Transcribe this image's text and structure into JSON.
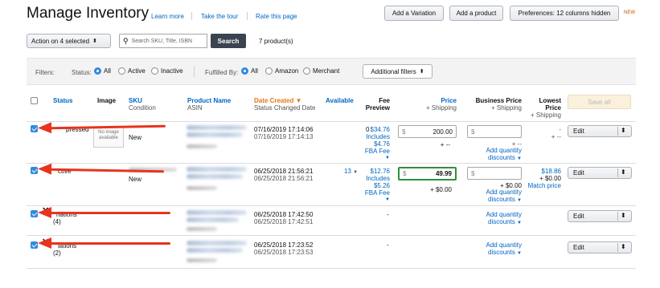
{
  "header": {
    "title": "Manage Inventory",
    "links": [
      "Learn more",
      "Take the tour",
      "Rate this page"
    ],
    "add_variation": "Add a Variation",
    "add_product": "Add a product",
    "preferences": "Preferences: 12 columns hidden",
    "new_badge": "NEW"
  },
  "toolbar": {
    "action_label": "Action on 4 selected",
    "search_placeholder": "Search SKU, Title, ISBN",
    "search_button": "Search",
    "product_count": "7 product(s)"
  },
  "filters": {
    "label": "Filters:",
    "status_label": "Status:",
    "status_options": [
      "All",
      "Active",
      "Inactive"
    ],
    "status_selected": "All",
    "fulfilled_label": "Fulfilled By:",
    "fulfilled_options": [
      "All",
      "Amazon",
      "Merchant"
    ],
    "fulfilled_selected": "All",
    "additional": "Additional filters"
  },
  "columns": {
    "status": "Status",
    "image": "Image",
    "sku": "SKU",
    "condition": "Condition",
    "product_name": "Product Name",
    "asin": "ASIN",
    "date_created": "Date Created",
    "status_changed": "Status Changed Date",
    "available": "Available",
    "fee": "Fee",
    "preview": "Preview",
    "price": "Price",
    "plus_shipping": "+ Shipping",
    "business_price": "Business Price",
    "lowest": "Lowest",
    "lowest_price": "Price",
    "save_all": "Save all"
  },
  "rows": [
    {
      "checked": true,
      "status_fragment": "pressed",
      "no_image": "No image available",
      "condition": "New",
      "date_created": "07/16/2019 17:14:06",
      "status_changed": "07/16/2019 17:14:13",
      "available": "0",
      "fee": [
        "$34.76",
        "Includes",
        "$4.76",
        "FBA Fee"
      ],
      "price_currency": "$",
      "price": "200.00",
      "shipping": "+ --",
      "business_currency": "$",
      "business_price": "",
      "business_shipping": "+ --",
      "add_quantity": [
        "Add quantity",
        "discounts"
      ],
      "lowest": [
        "-",
        "+ --"
      ],
      "edit": "Edit"
    },
    {
      "checked": true,
      "status_fragment": "ctive",
      "condition": "New",
      "date_created": "06/25/2018 21:56:21",
      "status_changed": "06/25/2018 21:56:21",
      "available": "13",
      "fee": [
        "$12.76",
        "Includes",
        "$5.26",
        "FBA Fee"
      ],
      "price_currency": "$",
      "price": "49.99",
      "shipping": "+ $0.00",
      "business_currency": "$",
      "business_price": "",
      "business_shipping": "+ $0.00",
      "add_quantity": [
        "Add quantity",
        "discounts"
      ],
      "lowest": [
        "$18.86",
        "+ $0.00",
        "Match price"
      ],
      "edit": "Edit"
    },
    {
      "checked": true,
      "status_fragment": "riations",
      "count": "(4)",
      "date_created": "06/25/2018 17:42:50",
      "status_changed": "06/25/2018 17:42:51",
      "fee_dash": "-",
      "add_quantity": [
        "Add quantity",
        "discounts"
      ],
      "edit": "Edit"
    },
    {
      "checked": true,
      "status_fragment": "iations",
      "count": "(2)",
      "date_created": "06/25/2018 17:23:52",
      "status_changed": "06/25/2018 17:23:53",
      "fee_dash": "-",
      "add_quantity": [
        "Add quantity",
        "discounts"
      ],
      "edit": "Edit"
    }
  ],
  "colors": {
    "link": "#0066c0",
    "date_header": "#e47911",
    "arrow": "#e8341c",
    "checkbox": "#2f8ae0",
    "focus_border": "#2f8f3a"
  }
}
